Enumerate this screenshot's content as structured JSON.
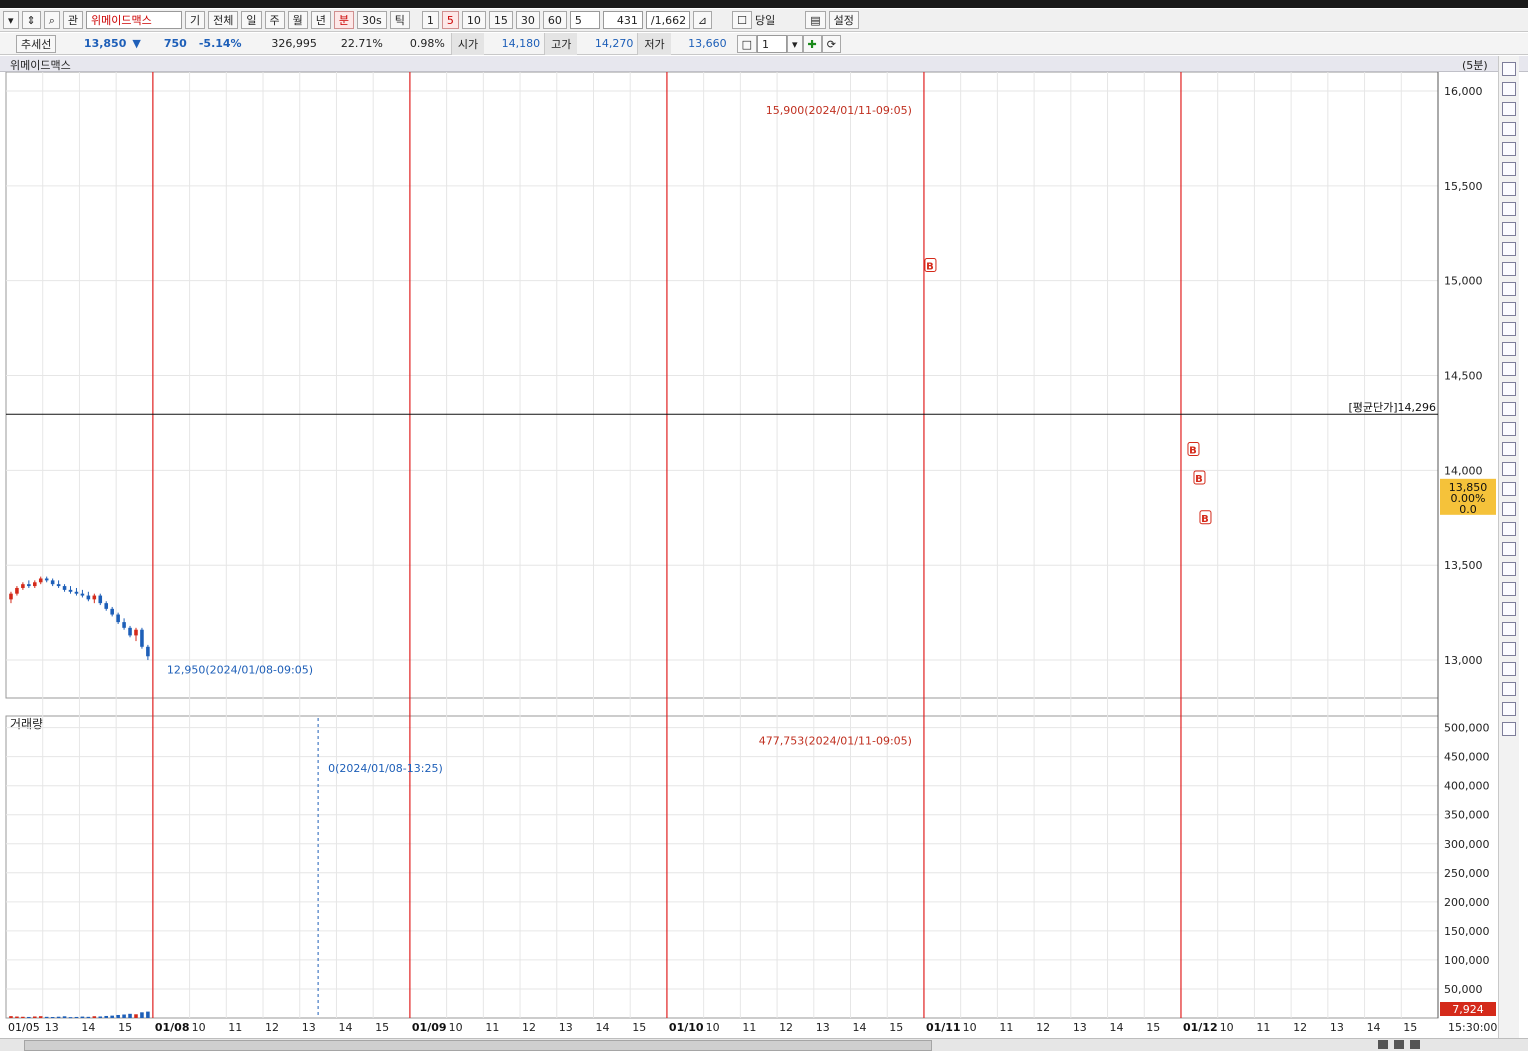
{
  "toolbar": {
    "search_icon": "magnifier-icon",
    "interest_label": "관",
    "stock_name": "위메이드맥스",
    "buttons": [
      "기",
      "전체",
      "일",
      "주",
      "월",
      "년",
      "분",
      "30s",
      "틱"
    ],
    "active_button": "분",
    "intervals": [
      "1",
      "5",
      "10",
      "15",
      "30",
      "60"
    ],
    "active_interval": "5",
    "spin_value": "5",
    "count_current": "431",
    "count_total": "/1,662",
    "today_label": "당일",
    "settings_label": "설정"
  },
  "quote": {
    "trend_label": "추세선",
    "price": "13,850",
    "change": "750",
    "change_pct": "-5.14%",
    "volume": "326,995",
    "turnover": "22.71%",
    "ratio": "0.98%",
    "open_label": "시가",
    "open": "14,180",
    "high_label": "고가",
    "high": "14,270",
    "low_label": "저가",
    "low": "13,660",
    "line_width": "1"
  },
  "chart_title": "위메이드맥스",
  "chart_interval": "(5분)",
  "volume_title": "거래량",
  "colors": {
    "up": "#d42a1a",
    "down": "#1e5fb8",
    "day_divider": "#e02020",
    "grid": "#e6e6e6",
    "badge": "#f5c23a"
  },
  "chart_data": {
    "type": "candlestick",
    "interval": "5분",
    "price_axis": {
      "ylim": [
        12800,
        16100
      ],
      "ticks": [
        13000,
        13500,
        14000,
        14500,
        15000,
        15500,
        16000
      ],
      "tick_labels": [
        "13,000",
        "13,500",
        "14,000",
        "14,500",
        "15,000",
        "15,500",
        "16,000"
      ]
    },
    "volume_axis": {
      "ylim": [
        0,
        520000
      ],
      "ticks": [
        50000,
        100000,
        150000,
        200000,
        250000,
        300000,
        350000,
        400000,
        450000,
        500000
      ],
      "tick_labels": [
        "50,000",
        "100,000",
        "150,000",
        "200,000",
        "250,000",
        "300,000",
        "350,000",
        "400,000",
        "450,000",
        "500,000"
      ]
    },
    "x_axis": {
      "days": [
        {
          "label": "01/05",
          "ticks": [
            "13",
            "14",
            "15"
          ]
        },
        {
          "label": "01/08",
          "ticks": [
            "10",
            "11",
            "12",
            "13",
            "14",
            "15"
          ]
        },
        {
          "label": "01/09",
          "ticks": [
            "10",
            "11",
            "12",
            "13",
            "14",
            "15"
          ]
        },
        {
          "label": "01/10",
          "ticks": [
            "10",
            "11",
            "12",
            "13",
            "14",
            "15"
          ]
        },
        {
          "label": "01/11",
          "ticks": [
            "10",
            "11",
            "12",
            "13",
            "14",
            "15"
          ]
        },
        {
          "label": "01/12",
          "ticks": [
            "10",
            "11",
            "12",
            "13",
            "14",
            "15"
          ]
        }
      ],
      "end_label": "15:30:00"
    },
    "average_price": {
      "label": "[평균단가]14,296",
      "value": 14296
    },
    "annotations": [
      {
        "text": "15,900(2024/01/11-09:05)",
        "value": 15900
      },
      {
        "text": "12,950(2024/01/08-09:05)",
        "value": 12950
      },
      {
        "text": "477,753(2024/01/11-09:05)",
        "value": 477753
      },
      {
        "text": "0(2024/01/08-13:25)",
        "value": 0
      }
    ],
    "buy_markers": [
      {
        "label": "B",
        "day": "01/11",
        "price": 15080
      },
      {
        "label": "B",
        "day": "01/12",
        "price": 14110
      },
      {
        "label": "B",
        "day": "01/12",
        "price": 13960
      },
      {
        "label": "B",
        "day": "01/12",
        "price": 13750
      }
    ],
    "last_badge": {
      "price": "13,850",
      "pct": "0.00%",
      "change": "0.0"
    },
    "last_volume_label": "7,924",
    "candles": {
      "01/05": [
        {
          "o": 13320,
          "h": 13360,
          "l": 13300,
          "c": 13350
        },
        {
          "o": 13350,
          "h": 13390,
          "l": 13340,
          "c": 13380
        },
        {
          "o": 13380,
          "h": 13410,
          "l": 13370,
          "c": 13400
        },
        {
          "o": 13400,
          "h": 13420,
          "l": 13380,
          "c": 13390
        },
        {
          "o": 13390,
          "h": 13420,
          "l": 13380,
          "c": 13410
        },
        {
          "o": 13410,
          "h": 13440,
          "l": 13400,
          "c": 13430
        },
        {
          "o": 13430,
          "h": 13440,
          "l": 13410,
          "c": 13420
        },
        {
          "o": 13420,
          "h": 13430,
          "l": 13390,
          "c": 13400
        },
        {
          "o": 13400,
          "h": 13420,
          "l": 13380,
          "c": 13390
        },
        {
          "o": 13390,
          "h": 13400,
          "l": 13360,
          "c": 13370
        },
        {
          "o": 13370,
          "h": 13390,
          "l": 13350,
          "c": 13360
        },
        {
          "o": 13360,
          "h": 13380,
          "l": 13340,
          "c": 13350
        },
        {
          "o": 13350,
          "h": 13370,
          "l": 13330,
          "c": 13340
        },
        {
          "o": 13340,
          "h": 13360,
          "l": 13310,
          "c": 13320
        },
        {
          "o": 13320,
          "h": 13350,
          "l": 13300,
          "c": 13340
        },
        {
          "o": 13340,
          "h": 13350,
          "l": 13290,
          "c": 13300
        },
        {
          "o": 13300,
          "h": 13310,
          "l": 13260,
          "c": 13270
        },
        {
          "o": 13270,
          "h": 13280,
          "l": 13230,
          "c": 13240
        },
        {
          "o": 13240,
          "h": 13250,
          "l": 13190,
          "c": 13200
        },
        {
          "o": 13200,
          "h": 13220,
          "l": 13160,
          "c": 13170
        },
        {
          "o": 13170,
          "h": 13180,
          "l": 13120,
          "c": 13130
        },
        {
          "o": 13130,
          "h": 13170,
          "l": 13100,
          "c": 13160
        },
        {
          "o": 13160,
          "h": 13170,
          "l": 13060,
          "c": 13070
        },
        {
          "o": 13070,
          "h": 13080,
          "l": 13000,
          "c": 13020
        }
      ]
    },
    "volumes": {
      "01/05": [
        3200,
        2500,
        2100,
        1800,
        2600,
        3100,
        2000,
        1700,
        2200,
        2900,
        1500,
        1800,
        2400,
        2000,
        3000,
        2600,
        3500,
        4100,
        5200,
        6000,
        7200,
        6400,
        9800,
        11000
      ]
    }
  }
}
